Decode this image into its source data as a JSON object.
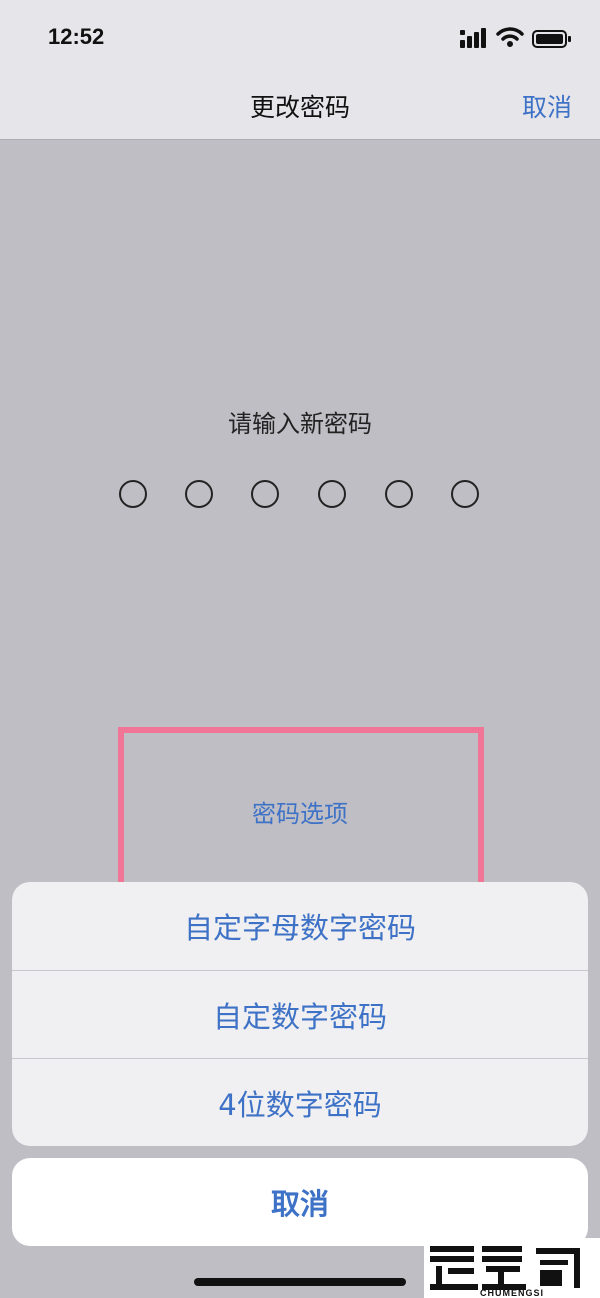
{
  "status_bar": {
    "time": "12:52",
    "icons": [
      "signal-icon",
      "wifi-icon",
      "battery-icon"
    ]
  },
  "nav": {
    "title": "更改密码",
    "cancel_label": "取消"
  },
  "prompt": {
    "text": "请输入新密码",
    "passcode_length": 6,
    "digits_entered": 0
  },
  "options_link": {
    "label": "密码选项",
    "highlighted": true,
    "highlight_color": "#f07597"
  },
  "action_sheet": {
    "items": [
      {
        "label": "自定字母数字密码"
      },
      {
        "label": "自定数字密码"
      },
      {
        "label": "4位数字密码"
      }
    ],
    "cancel_label": "取消"
  },
  "watermark": {
    "text": "楚梦司",
    "subtext": "CHUMENGSI"
  },
  "colors": {
    "accent": "#3e72c6",
    "overlay_background": "#bfbec4",
    "sheet_background": "#f0eff2"
  }
}
